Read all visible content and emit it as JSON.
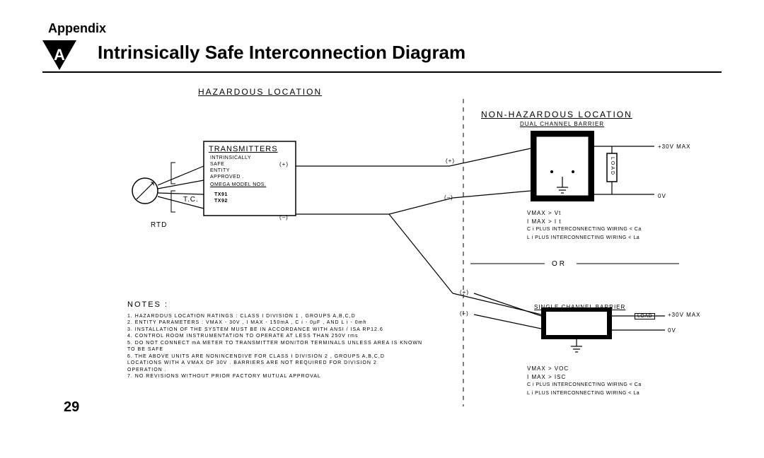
{
  "header": {
    "appendix": "Appendix",
    "badge": "A",
    "title": "Intrinsically Safe Interconnection Diagram"
  },
  "zones": {
    "hazardous": "HAZARDOUS  LOCATION",
    "nonhazardous": "NON-HAZARDOUS  LOCATION",
    "dual_barrier": "DUAL CHANNEL BARRIER",
    "single_barrier": "SINGLE CHANNEL BARRIER",
    "or": "OR"
  },
  "transmitter_box": {
    "title": "TRANSMITTERS",
    "lines": [
      "INTRINSICALLY",
      "SAFE",
      "ENTITY",
      "APPROVED ."
    ],
    "omega": "OMEGA MODEL NOS.",
    "models": [
      "TX91",
      "TX92"
    ]
  },
  "sensor": {
    "tc": "T.C.",
    "rtd": "RTD"
  },
  "rails": {
    "plus30": "+30V MAX",
    "zero": "0V",
    "load": "LOAD"
  },
  "signs": {
    "plus": "(+)",
    "minus": "(–)"
  },
  "dual_conditions": {
    "l1": "VMAX > Vt",
    "l2": "I MAX > I t",
    "l3": "C i PLUS INTERCONNECTING WIRING  <  Ca",
    "l4": "L i PLUS INTERCONNECTING WIRING  <  La"
  },
  "single_conditions": {
    "l1": "VMAX > VOC",
    "l2": "I MAX > ISC",
    "l3": "C i PLUS INTERCONNECTING WIRING  <  Ca",
    "l4": "L i PLUS INTERCONNECTING WIRING  <  La"
  },
  "notes": {
    "title": "NOTES :",
    "items": [
      "1. HAZARDOUS  LOCATION RATINGS : CLASS  I  DIVISION  1 , GROUPS  A,B,C,D",
      "2. ENTITY PARAMETERS : VMAX - 30V ,  I MAX - 150mA ,  C i - 0µF ,  AND  L i - 0mh",
      "3. INSTALLATION OF THE SYSTEM MUST BE IN ACCORDANCE WITH  ANSI / ISA  RP12.6",
      "4. CONTROL  ROOM  INSTRUMENTATION TO OPERATE  AT LESS THAN  250V  rms",
      "5. DO NOT CONNECT mA METER TO TRANSMITTER MONITOR TERMINALS UNLESS AREA IS KNOWN",
      "    TO BE SAFE",
      "6. THE  ABOVE  UNITS  ARE  NONINCENDIVE  FOR  CLASS  I  DIVISION  2 , GROUPS  A,B,C,D",
      "    LOCATIONS  WITH  A  VMAX  OF  30V .  BARRIERS  ARE  NOT  REQUIRED FOR  DIVISION  2",
      "    OPERATION .",
      "7. NO  REVISIONS  WITHOUT PRIOR  FACTORY  MUTUAL  APPROVAL"
    ]
  },
  "page": "29"
}
